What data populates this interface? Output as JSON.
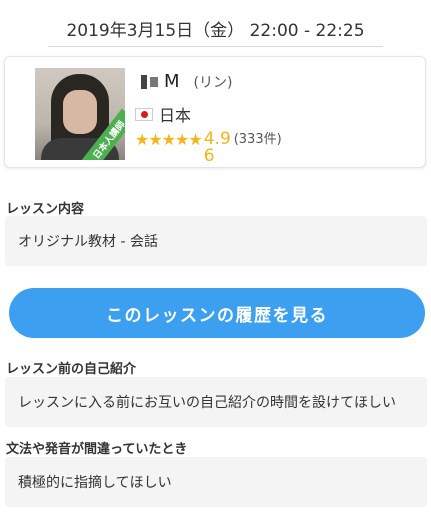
{
  "lesson": {
    "datetime": "2019年3月15日（金） 22:00 - 22:25"
  },
  "teacher": {
    "name": "M",
    "reading": "(リン)",
    "country": "日本",
    "badge": "日本人講師",
    "rating": "4.96",
    "rating_stars": 4.96,
    "review_count": "(333件)",
    "stars_glyphs": "★★★★★"
  },
  "sections": {
    "content_label": "レッスン内容",
    "content_value": "オリジナル教材 - 会話",
    "self_intro_label": "レッスン前の自己紹介",
    "self_intro_value": "レッスンに入る前にお互いの自己紹介の時間を設けてほしい",
    "mistakes_label": "文法や発音が間違っていたとき",
    "mistakes_value": "積極的に指摘してほしい"
  },
  "buttons": {
    "history": "このレッスンの履歴を見る"
  },
  "colors": {
    "accent": "#3d9ff0",
    "star": "#f2b51c",
    "badge": "#4caf50"
  },
  "icons": {
    "flag": "japan-flag-icon",
    "star": "star-icon"
  }
}
